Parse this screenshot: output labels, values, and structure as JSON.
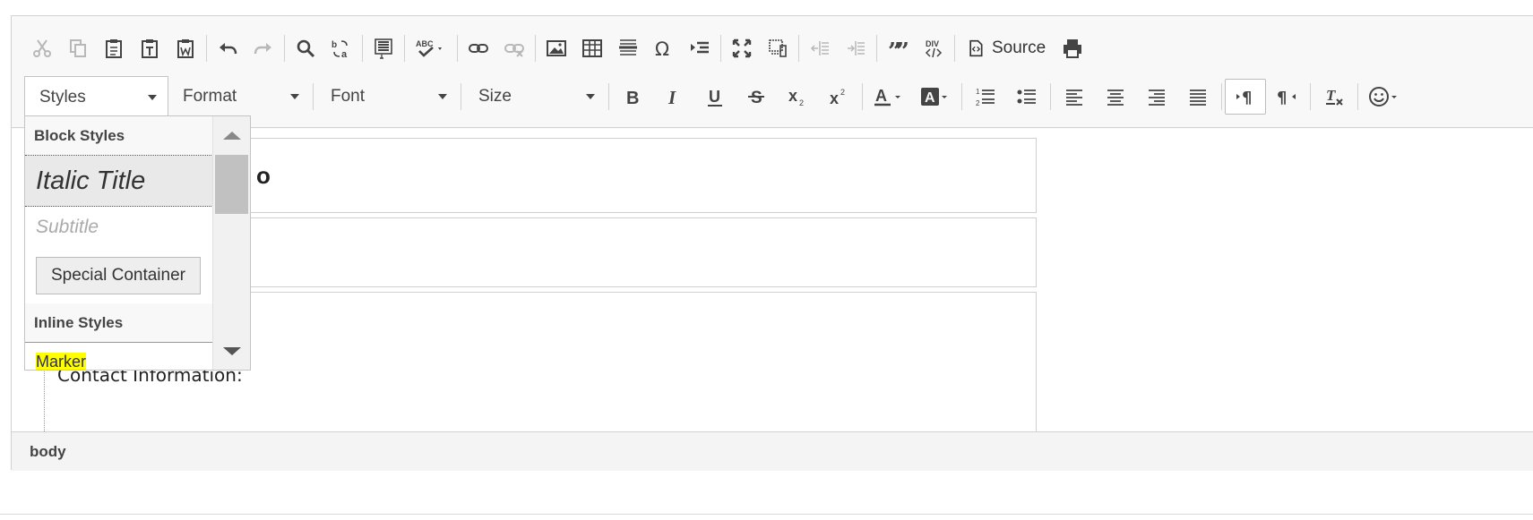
{
  "toolbar": {
    "row1": {
      "source_label": "Source"
    },
    "row2": {
      "styles_label": "Styles",
      "format_label": "Format",
      "font_label": "Font",
      "size_label": "Size"
    }
  },
  "content": {
    "block1_peek": "o",
    "block3_text": "Contact Information:"
  },
  "statusbar": {
    "path": "body"
  },
  "styles_dropdown": {
    "block_styles_heading": "Block Styles",
    "italic_title": "Italic Title",
    "subtitle": "Subtitle",
    "special_container": "Special Container",
    "inline_styles_heading": "Inline Styles",
    "marker": "Marker"
  },
  "colors": {
    "marker_highlight": "#ffff00",
    "toolbar_bg": "#f8f8f8",
    "border": "#d1d1d1"
  }
}
